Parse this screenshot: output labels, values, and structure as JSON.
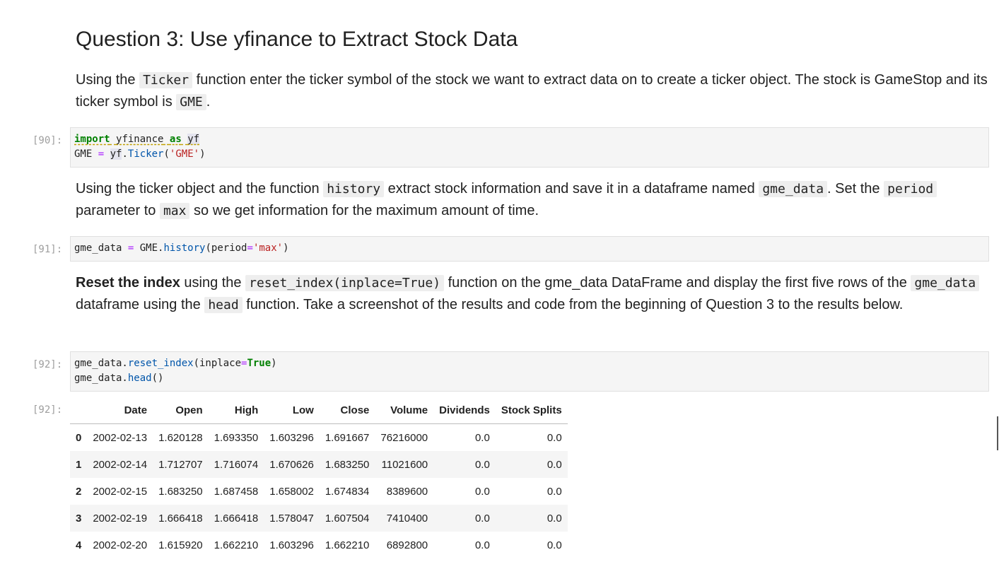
{
  "heading": "Question 3: Use yfinance to Extract Stock Data",
  "md1": {
    "t1": "Using the ",
    "c1": "Ticker",
    "t2": " function enter the ticker symbol of the stock we want to extract data on to create a ticker object. The stock is GameStop and its ticker symbol is ",
    "c2": "GME",
    "t3": "."
  },
  "cell1": {
    "prompt": "[90]:",
    "kw_import": "import",
    "mod": "yfinance",
    "kw_as": "as",
    "alias": "yf",
    "var": "GME",
    "eq": "=",
    "obj": "yf",
    "dot": ".",
    "fn": "Ticker",
    "lp": "(",
    "arg": "'GME'",
    "rp": ")"
  },
  "md2": {
    "t1": "Using the ticker object and the function ",
    "c1": "history",
    "t2": " extract stock information and save it in a dataframe named ",
    "c2": "gme_data",
    "t3": ". Set the ",
    "c3": "period",
    "t4": " parameter to ",
    "c4": "max",
    "t5": " so we get information for the maximum amount of time."
  },
  "cell2": {
    "prompt": "[91]:",
    "var": "gme_data",
    "eq": "=",
    "obj": "GME.",
    "fn": "history",
    "lp": "(period",
    "eq2": "=",
    "arg": "'max'",
    "rp": ")"
  },
  "md3": {
    "b1": "Reset the index",
    "t1": " using the ",
    "c1": "reset_index(inplace=True)",
    "t2": " function on the gme_data DataFrame and display the first five rows of the ",
    "c2": "gme_data",
    "t3": " dataframe using the ",
    "c3": "head",
    "t4": " function. Take a screenshot of the results and code from the beginning of Question 3 to the results below."
  },
  "cell3": {
    "prompt": "[92]:",
    "l1_obj": "gme_data.",
    "l1_fn": "reset_index",
    "l1_lp": "(inplace",
    "l1_eq": "=",
    "l1_val": "True",
    "l1_rp": ")",
    "l2_obj": "gme_data.",
    "l2_fn": "head",
    "l2_rp": "()"
  },
  "output": {
    "prompt": "[92]:",
    "columns": [
      "",
      "Date",
      "Open",
      "High",
      "Low",
      "Close",
      "Volume",
      "Dividends",
      "Stock Splits"
    ],
    "rows": [
      [
        "0",
        "2002-02-13",
        "1.620128",
        "1.693350",
        "1.603296",
        "1.691667",
        "76216000",
        "0.0",
        "0.0"
      ],
      [
        "1",
        "2002-02-14",
        "1.712707",
        "1.716074",
        "1.670626",
        "1.683250",
        "11021600",
        "0.0",
        "0.0"
      ],
      [
        "2",
        "2002-02-15",
        "1.683250",
        "1.687458",
        "1.658002",
        "1.674834",
        "8389600",
        "0.0",
        "0.0"
      ],
      [
        "3",
        "2002-02-19",
        "1.666418",
        "1.666418",
        "1.578047",
        "1.607504",
        "7410400",
        "0.0",
        "0.0"
      ],
      [
        "4",
        "2002-02-20",
        "1.615920",
        "1.662210",
        "1.603296",
        "1.662210",
        "6892800",
        "0.0",
        "0.0"
      ]
    ]
  }
}
